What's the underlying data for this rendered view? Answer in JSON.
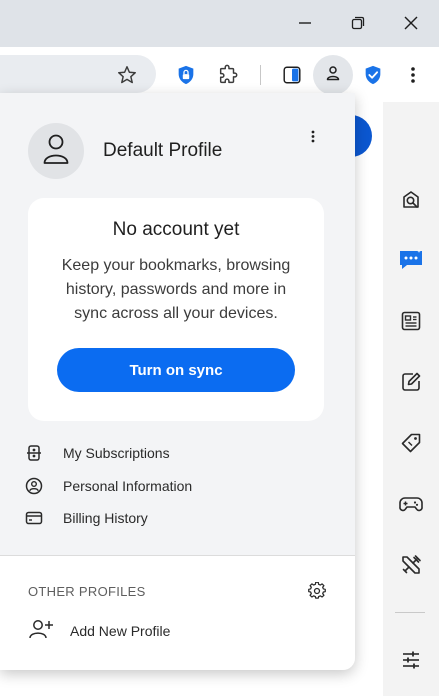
{
  "window": {
    "controls": [
      "minimize-icon",
      "restore-icon",
      "close-icon"
    ]
  },
  "toolbar": {
    "icons": [
      "star-icon",
      "vpn-lock-icon",
      "extensions-icon",
      "split-view-icon",
      "profile-icon",
      "shield-check-icon",
      "more-vertical-icon"
    ]
  },
  "sidebar": {
    "icons": [
      "search-web-icon",
      "chat-ai-icon",
      "news-icon",
      "notes-icon",
      "coupon-tag-icon",
      "games-icon",
      "tools-icon",
      "customize-sliders-icon"
    ]
  },
  "profile_menu": {
    "profile_name": "Default Profile",
    "card": {
      "title": "No account yet",
      "body": "Keep your bookmarks, browsing history, passwords and more in sync across all your devices.",
      "sync_button": "Turn on sync"
    },
    "items": [
      {
        "label": "My Subscriptions",
        "icon": "subscriptions-icon"
      },
      {
        "label": "Personal Information",
        "icon": "person-circle-icon"
      },
      {
        "label": "Billing History",
        "icon": "credit-card-icon"
      }
    ],
    "other_profiles": {
      "label": "OTHER PROFILES",
      "add_profile": "Add New Profile"
    }
  },
  "colors": {
    "accent": "#0b6cf1",
    "shield": "#1a73e8",
    "titlebar": "#dfe3e8"
  }
}
